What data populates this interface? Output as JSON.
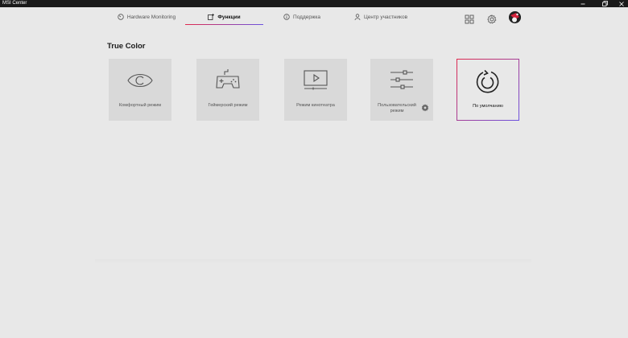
{
  "window": {
    "title": "MSI Center",
    "controls": [
      "minimize-icon",
      "restore-icon",
      "close-icon"
    ]
  },
  "nav": {
    "tabs": [
      {
        "label": "Hardware Monitoring",
        "icon": "gauge-icon",
        "active": false
      },
      {
        "label": "Функции",
        "icon": "features-icon",
        "active": true
      },
      {
        "label": "Поддержка",
        "icon": "info-icon",
        "active": false
      },
      {
        "label": "Центр участников",
        "icon": "user-icon",
        "active": false
      }
    ],
    "right_icons": [
      "grid-icon",
      "settings-gear-icon",
      "avatar"
    ]
  },
  "section": {
    "title": "True Color"
  },
  "cards": [
    {
      "label": "Комфортный режим",
      "icon": "eye-icon",
      "selected": false
    },
    {
      "label": "Геймерский режим",
      "icon": "gamepad-icon",
      "selected": false
    },
    {
      "label": "Режим кинотеатра",
      "icon": "play-screen-icon",
      "selected": false
    },
    {
      "label": "Пользовательский режим",
      "icon": "sliders-icon",
      "selected": false,
      "has_settings": true
    },
    {
      "label": "По умолчанию",
      "icon": "reset-icon",
      "selected": true
    }
  ],
  "colors": {
    "accent_red": "#e0284d",
    "accent_blue": "#6b52e0",
    "background": "#e8e8e8",
    "card": "#d9d9d9",
    "titlebar": "#1a1a1a"
  }
}
